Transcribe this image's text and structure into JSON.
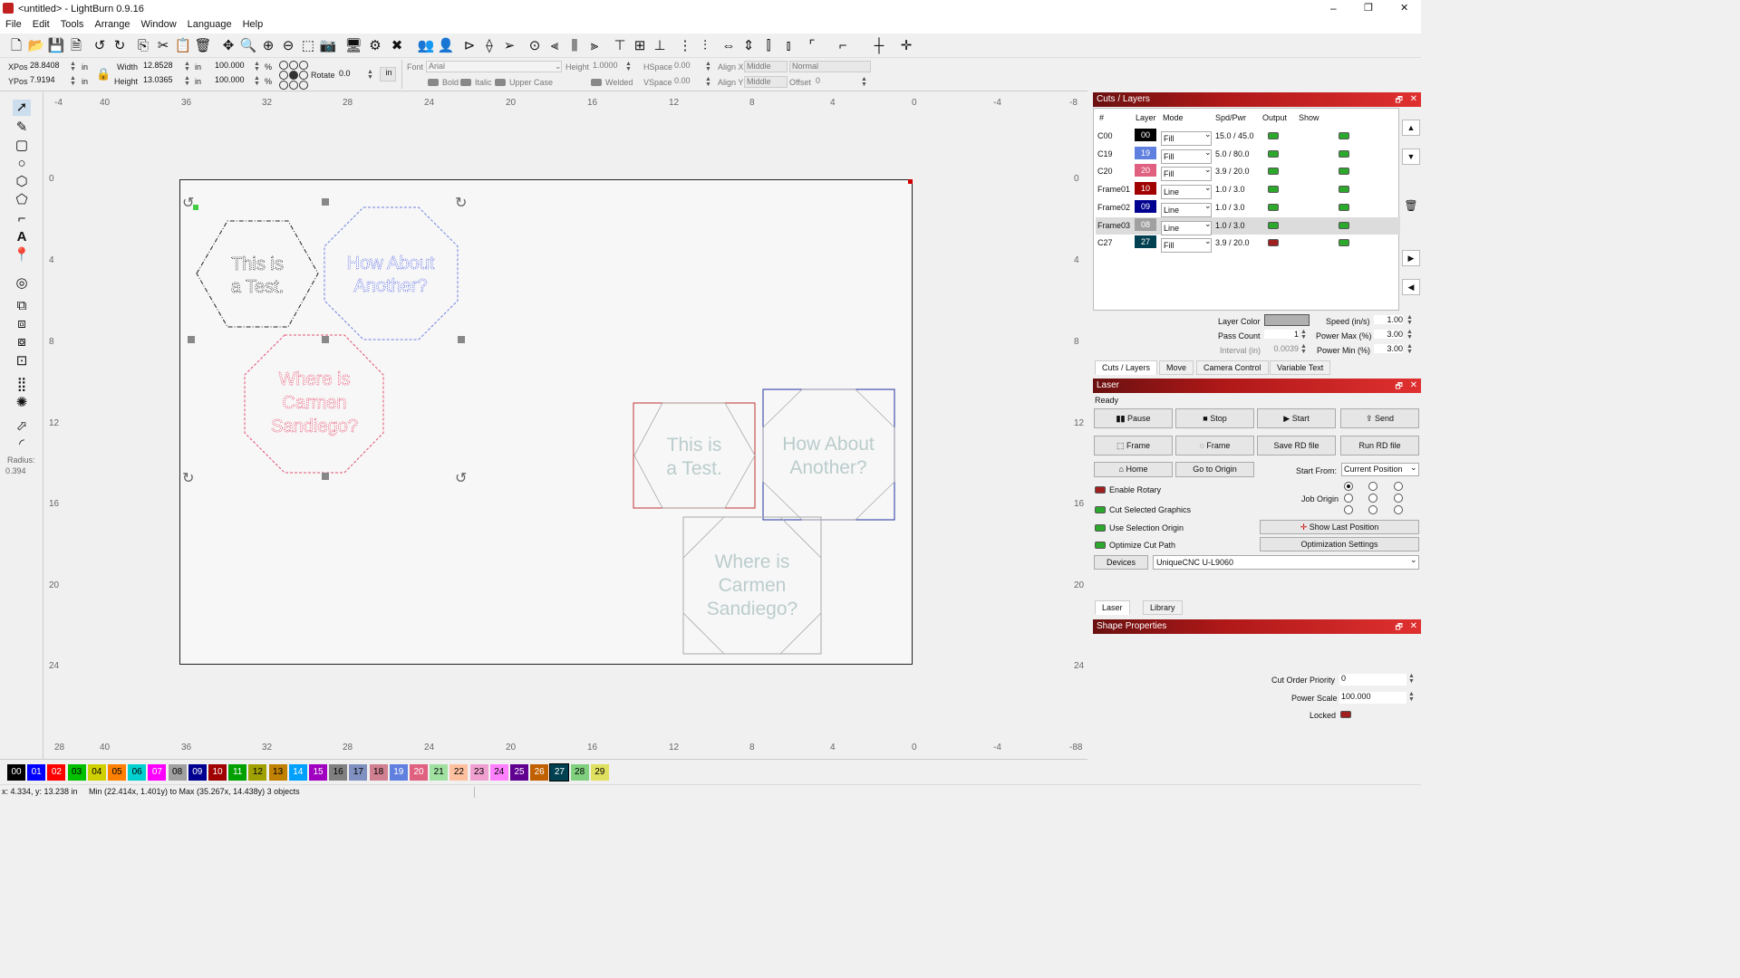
{
  "window": {
    "title": "<untitled> - LightBurn 0.9.16",
    "min": "–",
    "max": "❐",
    "close": "✕"
  },
  "menu": [
    "File",
    "Edit",
    "Tools",
    "Arrange",
    "Window",
    "Language",
    "Help"
  ],
  "props": {
    "xpos_label": "XPos",
    "xpos": "28.8408",
    "ypos_label": "YPos",
    "ypos": "7.9194",
    "unit": "in",
    "width_label": "Width",
    "width": "12.8528",
    "height_label": "Height",
    "height": "13.0365",
    "scale_w": "100.000",
    "scale_h": "100.000",
    "pct": "%",
    "rotate_label": "Rotate",
    "rotate": "0.0",
    "rot_unit": "in",
    "font_label": "Font",
    "font": "Arial",
    "fheight_label": "Height",
    "fheight": "1.0000",
    "hspace_label": "HSpace",
    "hspace": "0.00",
    "vspace_label": "VSpace",
    "vspace": "0.00",
    "alignx_label": "Align X",
    "alignx": "Middle",
    "aligny_label": "Align Y",
    "aligny": "Middle",
    "normal": "Normal",
    "offset_label": "Offset",
    "offset": "0",
    "bold": "Bold",
    "italic": "Italic",
    "upper": "Upper Case",
    "welded": "Welded"
  },
  "ruler": {
    "top": [
      "-4",
      "40",
      "36",
      "32",
      "28",
      "24",
      "20",
      "16",
      "12",
      "8",
      "4",
      "0",
      "-4",
      "-8"
    ],
    "bottom": [
      "28",
      "40",
      "36",
      "32",
      "28",
      "24",
      "20",
      "16",
      "12",
      "8",
      "4",
      "0",
      "-4",
      "-88"
    ],
    "left": [
      "0",
      "4",
      "8",
      "12",
      "16",
      "20",
      "24"
    ],
    "right": [
      "0",
      "4",
      "8",
      "12",
      "16",
      "20",
      "24"
    ]
  },
  "tool_radius_label": "Radius:",
  "tool_radius": "0.394",
  "shapes": {
    "hex1": [
      "This is",
      "a Test."
    ],
    "hex2": [
      "How About",
      "Another?"
    ],
    "oct1": [
      "Where is",
      "Carmen",
      "Sandiego?"
    ],
    "box1": [
      "This is",
      "a Test."
    ],
    "box2": [
      "How About",
      "Another?"
    ],
    "box3": [
      "Where is",
      "Carmen",
      "Sandiego?"
    ]
  },
  "palette": [
    {
      "n": "00",
      "c": "#000000",
      "t": "#ffffff"
    },
    {
      "n": "01",
      "c": "#0000ff",
      "t": "#ffffff"
    },
    {
      "n": "02",
      "c": "#ff0000",
      "t": "#ffffff"
    },
    {
      "n": "03",
      "c": "#00c000",
      "t": "#000000"
    },
    {
      "n": "04",
      "c": "#d0d000",
      "t": "#000000"
    },
    {
      "n": "05",
      "c": "#ff8000",
      "t": "#000000"
    },
    {
      "n": "06",
      "c": "#00d0d0",
      "t": "#000000"
    },
    {
      "n": "07",
      "c": "#ff00ff",
      "t": "#ffffff"
    },
    {
      "n": "08",
      "c": "#a0a0a0",
      "t": "#000000"
    },
    {
      "n": "09",
      "c": "#000090",
      "t": "#ffffff"
    },
    {
      "n": "10",
      "c": "#a00000",
      "t": "#ffffff"
    },
    {
      "n": "11",
      "c": "#00a000",
      "t": "#ffffff"
    },
    {
      "n": "12",
      "c": "#a0a000",
      "t": "#000000"
    },
    {
      "n": "13",
      "c": "#c08000",
      "t": "#000000"
    },
    {
      "n": "14",
      "c": "#00a0ff",
      "t": "#ffffff"
    },
    {
      "n": "15",
      "c": "#a000c0",
      "t": "#ffffff"
    },
    {
      "n": "16",
      "c": "#808080",
      "t": "#000000"
    },
    {
      "n": "17",
      "c": "#8090c0",
      "t": "#000000"
    },
    {
      "n": "18",
      "c": "#d08090",
      "t": "#000000"
    },
    {
      "n": "19",
      "c": "#6080e0",
      "t": "#ffffff"
    },
    {
      "n": "20",
      "c": "#e06080",
      "t": "#ffffff"
    },
    {
      "n": "21",
      "c": "#a0e0a0",
      "t": "#000000"
    },
    {
      "n": "22",
      "c": "#ffc0a0",
      "t": "#000000"
    },
    {
      "n": "23",
      "c": "#f0a0d0",
      "t": "#000000"
    },
    {
      "n": "24",
      "c": "#ff80ff",
      "t": "#000000"
    },
    {
      "n": "25",
      "c": "#600090",
      "t": "#ffffff"
    },
    {
      "n": "26",
      "c": "#c06000",
      "t": "#ffffff"
    },
    {
      "n": "27",
      "c": "#004050",
      "t": "#ffffff"
    },
    {
      "n": "28",
      "c": "#80d080",
      "t": "#000000"
    },
    {
      "n": "29",
      "c": "#e0e060",
      "t": "#000000"
    }
  ],
  "status": {
    "coords": "x: 4.334, y: 13.238 in",
    "range": "Min (22.414x, 1.401y) to Max (35.267x, 14.438y)  3 objects"
  },
  "cuts": {
    "title": "Cuts / Layers",
    "headers": [
      "#",
      "Layer",
      "Mode",
      "Spd/Pwr",
      "Output",
      "Show"
    ],
    "rows": [
      {
        "id": "C00",
        "layer": "00",
        "color": "#000000",
        "mode": "Fill",
        "sp": "15.0 / 45.0",
        "out": true
      },
      {
        "id": "C19",
        "layer": "19",
        "color": "#6080e0",
        "mode": "Fill",
        "sp": "5.0 / 80.0",
        "out": true
      },
      {
        "id": "C20",
        "layer": "20",
        "color": "#e06080",
        "mode": "Fill",
        "sp": "3.9 / 20.0",
        "out": true
      },
      {
        "id": "Frame01",
        "layer": "10",
        "color": "#a00000",
        "mode": "Line",
        "sp": "1.0 / 3.0",
        "out": true
      },
      {
        "id": "Frame02",
        "layer": "09",
        "color": "#000090",
        "mode": "Line",
        "sp": "1.0 / 3.0",
        "out": true
      },
      {
        "id": "Frame03",
        "layer": "08",
        "color": "#a0a0a0",
        "mode": "Line",
        "sp": "1.0 / 3.0",
        "out": true
      },
      {
        "id": "C27",
        "layer": "27",
        "color": "#004050",
        "mode": "Fill",
        "sp": "3.9 / 20.0",
        "out": false
      }
    ],
    "layer_color_label": "Layer Color",
    "speed_label": "Speed (in/s)",
    "speed": "1.00",
    "pass_label": "Pass Count",
    "pass": "1",
    "pmax_label": "Power Max (%)",
    "pmax": "3.00",
    "interval_label": "Interval (in)",
    "interval": "0.0039",
    "pmin_label": "Power Min (%)",
    "pmin": "3.00",
    "tabs": [
      "Cuts / Layers",
      "Move",
      "Camera Control",
      "Variable Text"
    ]
  },
  "laser": {
    "title": "Laser",
    "status": "Ready",
    "pause": "Pause",
    "stop": "Stop",
    "start": "Start",
    "send": "Send",
    "frame1": "Frame",
    "frame2": "Frame",
    "save_rd": "Save RD file",
    "run_rd": "Run RD file",
    "home": "Home",
    "goto_origin": "Go to Origin",
    "start_from_label": "Start From:",
    "start_from": "Current Position",
    "enable_rotary": "Enable Rotary",
    "cut_selected": "Cut Selected Graphics",
    "use_sel_origin": "Use Selection Origin",
    "optimize": "Optimize Cut Path",
    "job_origin": "Job Origin",
    "show_last": "Show Last Position",
    "opt_settings": "Optimization Settings",
    "devices": "Devices",
    "device": "UniqueCNC U-L9060",
    "tabs": [
      "Laser",
      "Library"
    ]
  },
  "shape": {
    "title": "Shape Properties",
    "cut_order_label": "Cut Order Priority",
    "cut_order": "0",
    "power_scale_label": "Power Scale",
    "power_scale": "100.000",
    "locked_label": "Locked"
  }
}
